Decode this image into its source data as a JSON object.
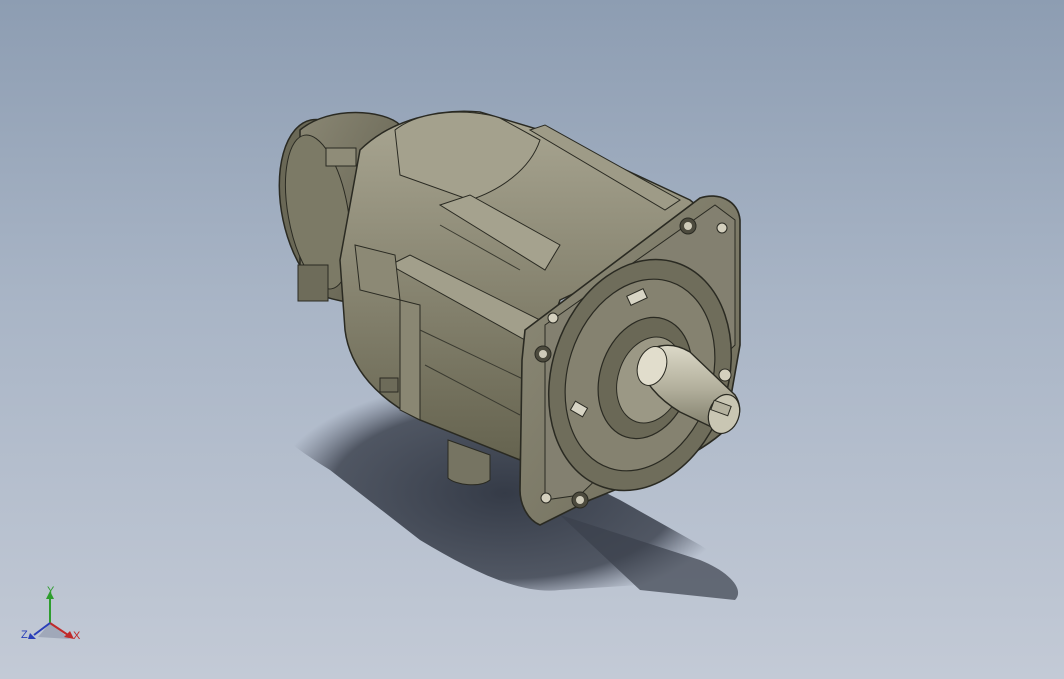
{
  "viewport": {
    "model": "servo-motor-3d-model"
  },
  "triad": {
    "x_label": "X",
    "y_label": "Y",
    "z_label": "Z",
    "colors": {
      "x": "#c02a2a",
      "y": "#2e9d2e",
      "z": "#2a3fb8"
    }
  }
}
